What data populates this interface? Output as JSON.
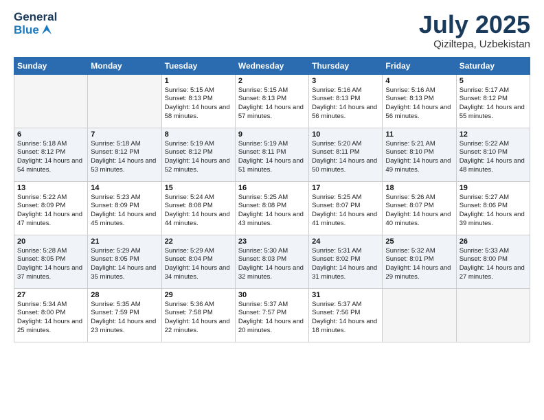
{
  "logo": {
    "general": "General",
    "blue": "Blue"
  },
  "title": "July 2025",
  "location": "Qiziltepa, Uzbekistan",
  "weekdays": [
    "Sunday",
    "Monday",
    "Tuesday",
    "Wednesday",
    "Thursday",
    "Friday",
    "Saturday"
  ],
  "weeks": [
    [
      {
        "day": "",
        "empty": true
      },
      {
        "day": "",
        "empty": true
      },
      {
        "day": "1",
        "sunrise": "Sunrise: 5:15 AM",
        "sunset": "Sunset: 8:13 PM",
        "daylight": "Daylight: 14 hours and 58 minutes."
      },
      {
        "day": "2",
        "sunrise": "Sunrise: 5:15 AM",
        "sunset": "Sunset: 8:13 PM",
        "daylight": "Daylight: 14 hours and 57 minutes."
      },
      {
        "day": "3",
        "sunrise": "Sunrise: 5:16 AM",
        "sunset": "Sunset: 8:13 PM",
        "daylight": "Daylight: 14 hours and 56 minutes."
      },
      {
        "day": "4",
        "sunrise": "Sunrise: 5:16 AM",
        "sunset": "Sunset: 8:13 PM",
        "daylight": "Daylight: 14 hours and 56 minutes."
      },
      {
        "day": "5",
        "sunrise": "Sunrise: 5:17 AM",
        "sunset": "Sunset: 8:12 PM",
        "daylight": "Daylight: 14 hours and 55 minutes."
      }
    ],
    [
      {
        "day": "6",
        "sunrise": "Sunrise: 5:18 AM",
        "sunset": "Sunset: 8:12 PM",
        "daylight": "Daylight: 14 hours and 54 minutes."
      },
      {
        "day": "7",
        "sunrise": "Sunrise: 5:18 AM",
        "sunset": "Sunset: 8:12 PM",
        "daylight": "Daylight: 14 hours and 53 minutes."
      },
      {
        "day": "8",
        "sunrise": "Sunrise: 5:19 AM",
        "sunset": "Sunset: 8:12 PM",
        "daylight": "Daylight: 14 hours and 52 minutes."
      },
      {
        "day": "9",
        "sunrise": "Sunrise: 5:19 AM",
        "sunset": "Sunset: 8:11 PM",
        "daylight": "Daylight: 14 hours and 51 minutes."
      },
      {
        "day": "10",
        "sunrise": "Sunrise: 5:20 AM",
        "sunset": "Sunset: 8:11 PM",
        "daylight": "Daylight: 14 hours and 50 minutes."
      },
      {
        "day": "11",
        "sunrise": "Sunrise: 5:21 AM",
        "sunset": "Sunset: 8:10 PM",
        "daylight": "Daylight: 14 hours and 49 minutes."
      },
      {
        "day": "12",
        "sunrise": "Sunrise: 5:22 AM",
        "sunset": "Sunset: 8:10 PM",
        "daylight": "Daylight: 14 hours and 48 minutes."
      }
    ],
    [
      {
        "day": "13",
        "sunrise": "Sunrise: 5:22 AM",
        "sunset": "Sunset: 8:09 PM",
        "daylight": "Daylight: 14 hours and 47 minutes."
      },
      {
        "day": "14",
        "sunrise": "Sunrise: 5:23 AM",
        "sunset": "Sunset: 8:09 PM",
        "daylight": "Daylight: 14 hours and 45 minutes."
      },
      {
        "day": "15",
        "sunrise": "Sunrise: 5:24 AM",
        "sunset": "Sunset: 8:08 PM",
        "daylight": "Daylight: 14 hours and 44 minutes."
      },
      {
        "day": "16",
        "sunrise": "Sunrise: 5:25 AM",
        "sunset": "Sunset: 8:08 PM",
        "daylight": "Daylight: 14 hours and 43 minutes."
      },
      {
        "day": "17",
        "sunrise": "Sunrise: 5:25 AM",
        "sunset": "Sunset: 8:07 PM",
        "daylight": "Daylight: 14 hours and 41 minutes."
      },
      {
        "day": "18",
        "sunrise": "Sunrise: 5:26 AM",
        "sunset": "Sunset: 8:07 PM",
        "daylight": "Daylight: 14 hours and 40 minutes."
      },
      {
        "day": "19",
        "sunrise": "Sunrise: 5:27 AM",
        "sunset": "Sunset: 8:06 PM",
        "daylight": "Daylight: 14 hours and 39 minutes."
      }
    ],
    [
      {
        "day": "20",
        "sunrise": "Sunrise: 5:28 AM",
        "sunset": "Sunset: 8:05 PM",
        "daylight": "Daylight: 14 hours and 37 minutes."
      },
      {
        "day": "21",
        "sunrise": "Sunrise: 5:29 AM",
        "sunset": "Sunset: 8:05 PM",
        "daylight": "Daylight: 14 hours and 35 minutes."
      },
      {
        "day": "22",
        "sunrise": "Sunrise: 5:29 AM",
        "sunset": "Sunset: 8:04 PM",
        "daylight": "Daylight: 14 hours and 34 minutes."
      },
      {
        "day": "23",
        "sunrise": "Sunrise: 5:30 AM",
        "sunset": "Sunset: 8:03 PM",
        "daylight": "Daylight: 14 hours and 32 minutes."
      },
      {
        "day": "24",
        "sunrise": "Sunrise: 5:31 AM",
        "sunset": "Sunset: 8:02 PM",
        "daylight": "Daylight: 14 hours and 31 minutes."
      },
      {
        "day": "25",
        "sunrise": "Sunrise: 5:32 AM",
        "sunset": "Sunset: 8:01 PM",
        "daylight": "Daylight: 14 hours and 29 minutes."
      },
      {
        "day": "26",
        "sunrise": "Sunrise: 5:33 AM",
        "sunset": "Sunset: 8:00 PM",
        "daylight": "Daylight: 14 hours and 27 minutes."
      }
    ],
    [
      {
        "day": "27",
        "sunrise": "Sunrise: 5:34 AM",
        "sunset": "Sunset: 8:00 PM",
        "daylight": "Daylight: 14 hours and 25 minutes."
      },
      {
        "day": "28",
        "sunrise": "Sunrise: 5:35 AM",
        "sunset": "Sunset: 7:59 PM",
        "daylight": "Daylight: 14 hours and 23 minutes."
      },
      {
        "day": "29",
        "sunrise": "Sunrise: 5:36 AM",
        "sunset": "Sunset: 7:58 PM",
        "daylight": "Daylight: 14 hours and 22 minutes."
      },
      {
        "day": "30",
        "sunrise": "Sunrise: 5:37 AM",
        "sunset": "Sunset: 7:57 PM",
        "daylight": "Daylight: 14 hours and 20 minutes."
      },
      {
        "day": "31",
        "sunrise": "Sunrise: 5:37 AM",
        "sunset": "Sunset: 7:56 PM",
        "daylight": "Daylight: 14 hours and 18 minutes."
      },
      {
        "day": "",
        "empty": true
      },
      {
        "day": "",
        "empty": true
      }
    ]
  ]
}
